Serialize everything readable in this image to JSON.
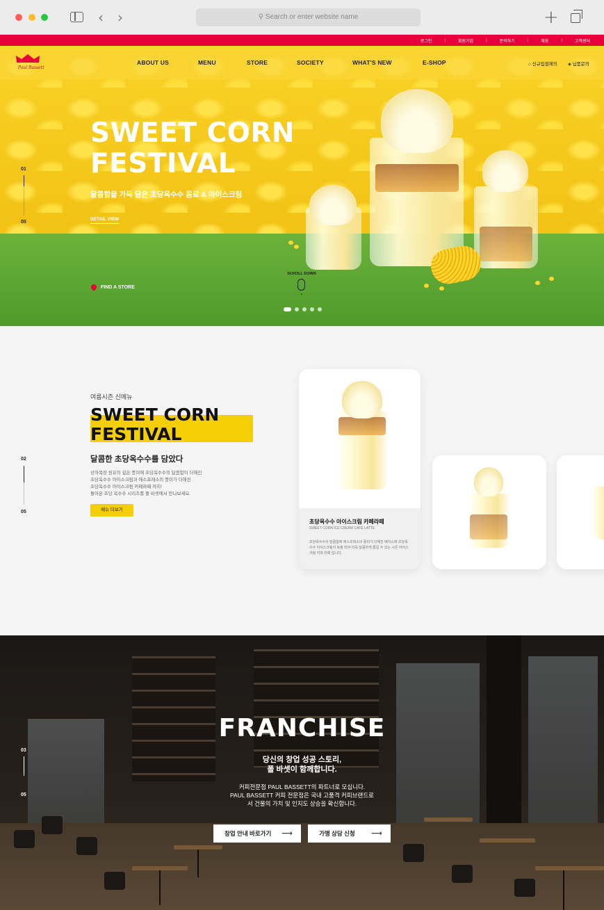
{
  "browser": {
    "url_placeholder": "Search or enter website name",
    "back_glyph": "‹",
    "forward_glyph": "›",
    "new_tab_glyph": "+"
  },
  "utility_nav": [
    "로그인",
    "회원가입",
    "문의하기",
    "채용",
    "고객센터"
  ],
  "logo": {
    "text": "Paul Bassett"
  },
  "gnb": {
    "items": [
      "ABOUT US",
      "MENU",
      "STORE",
      "SOCIETY",
      "WHAT'S NEW",
      "E-SHOP"
    ],
    "right": [
      "신규입점제의",
      "납품문의"
    ]
  },
  "hero": {
    "title_line1": "SWEET CORN",
    "title_line2": "FESTIVAL",
    "subtitle": "달콤함을 가득 담은 초당옥수수 음료 & 아이스크림",
    "detail_link": "DETAIL VIEW",
    "find_store": "FIND A STORE",
    "scroll_label": "SCROLL DOWN",
    "pager_start": "01",
    "pager_end": "05",
    "slide_count": 5,
    "active_slide": 1
  },
  "new_menu": {
    "eyebrow": "여름시즌 신메뉴",
    "title_line1": "SWEET CORN",
    "title_line2": "FESTIVAL",
    "subtitle": "달콤한 초당옥수수를 담았다",
    "desc_lines": [
      "상하목장 원유의 깊은 풍미에 초당옥수수의 달콤함이 더해진",
      "초당옥수수 아이스크림과 에스프레소의 풍미가 더해진",
      "초당옥수수 아이스크림 카페라떼 까지!",
      "돌아온 초당 옥수수 시리즈를 폴 바셋에서 만나보세요."
    ],
    "button": "메뉴 더보기",
    "pager_start": "02",
    "pager_end": "05",
    "featured": {
      "name": "초당옥수수 아이스크림 카페라떼",
      "name_en": "SWEET CORN ICE CREAM CAFE LATTE",
      "desc": "초당옥수수의 달콤함에 에스프레소의 풍미가 더해진 베이스에 초당옥수수 아이스크림이 토핑 되어 더욱 달콤하게 즐길 수 있는 시즌 아이스크림 커피 라떼 입니다."
    }
  },
  "franchise": {
    "title": "FRANCHISE",
    "sub_line1": "당신의 창업 성공 스토리,",
    "sub_line2": "폴 바셋이 함께합니다.",
    "desc_line1": "커피전문점 PAUL BASSETT의 파트너로 모십니다.",
    "desc_line2": "PAUL BASSETT 커피 전문점은 국내 고품격 커피브랜드로",
    "desc_line3": "서 건물의 가치 및 인지도 상승을 확신합니다.",
    "btn1": "창업 안내 바로가기",
    "btn2": "가맹 상담 신청",
    "arrow": "⟶",
    "pager_start": "03",
    "pager_end": "05"
  },
  "colors": {
    "accent_red": "#e8003c",
    "brand_yellow": "#f5cf06",
    "hero_green": "#5aa532"
  }
}
